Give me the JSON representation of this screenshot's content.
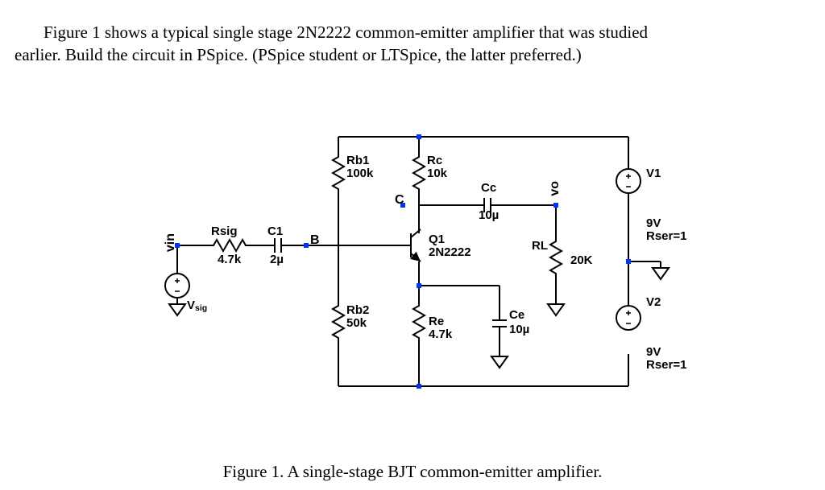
{
  "text": {
    "para1a": "Figure 1 shows a typical single stage 2N2222 common-emitter amplifier that was studied",
    "para1b": "earlier. Build the circuit in PSpice. (PSpice student or LTSpice, the latter preferred.)",
    "caption": "Figure 1. A single-stage BJT common-emitter amplifier."
  },
  "nodes": {
    "vin": "vin",
    "B": "B",
    "C": "C",
    "vo": "vo"
  },
  "components": {
    "Vsig": {
      "name": "V",
      "sub": "sig",
      "val": ""
    },
    "Rsig": {
      "name": "Rsig",
      "val": "4.7k"
    },
    "C1": {
      "name": "C1",
      "val": "2µ"
    },
    "Rb1": {
      "name": "Rb1",
      "val": "100k"
    },
    "Rb2": {
      "name": "Rb2",
      "val": "50k"
    },
    "Rc": {
      "name": "Rc",
      "val": "10k"
    },
    "Re": {
      "name": "Re",
      "val": "4.7k"
    },
    "Q1": {
      "name": "Q1",
      "val": "2N2222"
    },
    "Cc": {
      "name": "Cc",
      "val": "10µ"
    },
    "Ce": {
      "name": "Ce",
      "val": "10µ"
    },
    "RL": {
      "name": "RL",
      "val": "20K"
    },
    "V1": {
      "name": "V1",
      "val1": "9V",
      "val2": "Rser=1"
    },
    "V2": {
      "name": "V2",
      "val1": "9V",
      "val2": "Rser=1"
    }
  },
  "chart_data": {
    "type": "schematic",
    "title": "A single-stage BJT common-emitter amplifier",
    "device": "2N2222",
    "nets": [
      "vin",
      "B",
      "C",
      "vo",
      "GND",
      "+Vrail",
      "-Vrail"
    ],
    "parts": [
      {
        "ref": "Vsig",
        "type": "vsource",
        "nodes": [
          "vin",
          "GND"
        ]
      },
      {
        "ref": "Rsig",
        "type": "resistor",
        "value": "4.7k",
        "nodes": [
          "vin",
          "C1.a"
        ]
      },
      {
        "ref": "C1",
        "type": "capacitor",
        "value": "2u",
        "nodes": [
          "C1.a",
          "B"
        ]
      },
      {
        "ref": "Rb1",
        "type": "resistor",
        "value": "100k",
        "nodes": [
          "+Vrail",
          "B"
        ]
      },
      {
        "ref": "Rb2",
        "type": "resistor",
        "value": "50k",
        "nodes": [
          "B",
          "-Vrail"
        ]
      },
      {
        "ref": "Rc",
        "type": "resistor",
        "value": "10k",
        "nodes": [
          "+Vrail",
          "C"
        ]
      },
      {
        "ref": "Q1",
        "type": "npn",
        "model": "2N2222",
        "nodes": {
          "C": "C",
          "B": "B",
          "E": "E"
        }
      },
      {
        "ref": "Re",
        "type": "resistor",
        "value": "4.7k",
        "nodes": [
          "E",
          "-Vrail"
        ]
      },
      {
        "ref": "Ce",
        "type": "capacitor",
        "value": "10u",
        "nodes": [
          "E",
          "GND"
        ]
      },
      {
        "ref": "Cc",
        "type": "capacitor",
        "value": "10u",
        "nodes": [
          "C",
          "vo"
        ]
      },
      {
        "ref": "RL",
        "type": "resistor",
        "value": "20k",
        "nodes": [
          "vo",
          "GND"
        ]
      },
      {
        "ref": "V1",
        "type": "vsource",
        "value": "9V",
        "rser": "1",
        "nodes": [
          "+Vrail",
          "GND"
        ]
      },
      {
        "ref": "V2",
        "type": "vsource",
        "value": "9V",
        "rser": "1",
        "nodes": [
          "GND",
          "-Vrail"
        ]
      }
    ]
  }
}
